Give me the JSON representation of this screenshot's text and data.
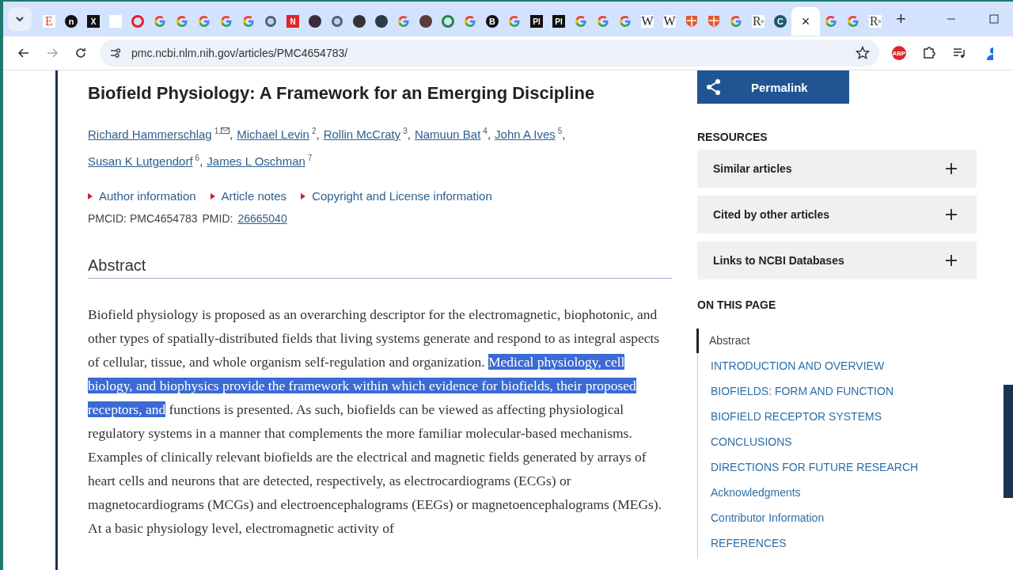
{
  "browser": {
    "tabs": [
      {
        "kind": "letter",
        "glyph": "E",
        "color": "#d9472b",
        "selected": false
      },
      {
        "kind": "round",
        "glyph": "n",
        "color": "#111111",
        "selected": false
      },
      {
        "kind": "square",
        "glyph": "X",
        "color": "#111111",
        "selected": false
      },
      {
        "kind": "blank",
        "selected": false
      },
      {
        "kind": "ring",
        "color": "#e0242b",
        "selected": false
      },
      {
        "kind": "google",
        "selected": false
      },
      {
        "kind": "google",
        "selected": false
      },
      {
        "kind": "google",
        "selected": false
      },
      {
        "kind": "google",
        "selected": false
      },
      {
        "kind": "google",
        "selected": false
      },
      {
        "kind": "seal",
        "color": "#4a5f86",
        "selected": false
      },
      {
        "kind": "square",
        "glyph": "N",
        "color": "#e0242b",
        "selected": false
      },
      {
        "kind": "dot",
        "color": "#3b2b3a",
        "selected": false
      },
      {
        "kind": "seal",
        "color": "#4a5f86",
        "selected": false
      },
      {
        "kind": "dot",
        "color": "#333333",
        "selected": false
      },
      {
        "kind": "dot",
        "color": "#2d3a4a",
        "selected": false
      },
      {
        "kind": "google",
        "selected": false
      },
      {
        "kind": "dot",
        "color": "#5a3a3a",
        "selected": false
      },
      {
        "kind": "ring",
        "color": "#1e8a4a",
        "selected": false
      },
      {
        "kind": "google",
        "selected": false
      },
      {
        "kind": "round",
        "glyph": "B",
        "color": "#111111",
        "selected": false
      },
      {
        "kind": "google",
        "selected": false
      },
      {
        "kind": "square",
        "glyph": "PI",
        "color": "#111111",
        "selected": false
      },
      {
        "kind": "square",
        "glyph": "PI",
        "color": "#111111",
        "selected": false
      },
      {
        "kind": "google",
        "selected": false
      },
      {
        "kind": "google",
        "selected": false
      },
      {
        "kind": "google",
        "selected": false
      },
      {
        "kind": "letter",
        "glyph": "W",
        "color": "#222222",
        "selected": false
      },
      {
        "kind": "letter",
        "glyph": "W",
        "color": "#222222",
        "selected": false
      },
      {
        "kind": "shield",
        "color": "#e05a2b",
        "selected": false
      },
      {
        "kind": "shield",
        "color": "#e05a2b",
        "selected": false
      },
      {
        "kind": "google",
        "selected": false
      },
      {
        "kind": "letter",
        "glyph": "R",
        "sup": "6",
        "color": "#333333",
        "selected": false
      },
      {
        "kind": "round",
        "glyph": "C",
        "color": "#1a5a70",
        "selected": false
      },
      {
        "kind": "active",
        "close": "×",
        "selected": true
      },
      {
        "kind": "google",
        "selected": false
      },
      {
        "kind": "google",
        "selected": false
      },
      {
        "kind": "letter",
        "glyph": "R",
        "sup": "6",
        "color": "#333333",
        "selected": false
      }
    ],
    "new_tab": "+",
    "url": "pmc.ncbi.nlm.nih.gov/articles/PMC4654783/",
    "extension_badge": "ABP"
  },
  "article": {
    "title": "Biofield Physiology: A Framework for an Emerging Discipline",
    "authors": [
      {
        "name": "Richard Hammerschlag",
        "sup": "1,",
        "mail": true,
        "separator": ","
      },
      {
        "name": "Michael Levin",
        "sup": "2",
        "mail": false,
        "separator": ","
      },
      {
        "name": "Rollin McCraty",
        "sup": "3",
        "mail": false,
        "separator": ","
      },
      {
        "name": "Namuun Bat",
        "sup": "4",
        "mail": false,
        "separator": ","
      },
      {
        "name": "John A Ives",
        "sup": "5",
        "mail": false,
        "separator": ","
      },
      {
        "name": "Susan K Lutgendorf",
        "sup": "6",
        "mail": false,
        "separator": ","
      },
      {
        "name": "James L Oschman",
        "sup": "7",
        "mail": false
      }
    ],
    "info_links": [
      "Author information",
      "Article notes",
      "Copyright and License information"
    ],
    "pmcid_label": "PMCID: PMC4654783",
    "pmid_label": "PMID:",
    "pmid": "26665040",
    "section_heading": "Abstract",
    "abstract": [
      {
        "text": "Biofield physiology is proposed as an overarching descriptor for the electromagnetic, biophotonic, and other types of spatially-distributed fields that living systems generate and respond to as integral aspects of cellular, tissue, and whole organism self-regulation and organization. ",
        "selected": false
      },
      {
        "text": "Medical physiology, cell biology, and biophysics provide the framework within which evidence for biofields, their proposed receptors, and",
        "selected": true
      },
      {
        "text": " functions is presented. As such, biofields can be viewed as affecting physiological regulatory systems in a manner that complements the more familiar molecular-based mechanisms. Examples of clinically relevant biofields are the electrical and magnetic fields generated by arrays of heart cells and neurons that are detected, respectively, as electrocardiograms (ECGs) or magnetocardiograms (MCGs) and electroencephalograms (EEGs) or magnetoencephalograms (MEGs). At a basic physiology level, electromagnetic activity of",
        "selected": false
      }
    ]
  },
  "sidebar": {
    "permalink": "Permalink",
    "resources_heading": "RESOURCES",
    "resources": [
      {
        "label": "Similar articles",
        "expanded": false
      },
      {
        "label": "Cited by other articles",
        "expanded": false
      },
      {
        "label": "Links to NCBI Databases",
        "expanded": false
      }
    ],
    "toc_heading": "ON THIS PAGE",
    "toc": [
      {
        "label": "Abstract",
        "selected": true
      },
      {
        "label": "INTRODUCTION AND OVERVIEW",
        "selected": false
      },
      {
        "label": "BIOFIELDS: FORM AND FUNCTION",
        "selected": false
      },
      {
        "label": "BIOFIELD RECEPTOR SYSTEMS",
        "selected": false
      },
      {
        "label": "CONCLUSIONS",
        "selected": false
      },
      {
        "label": "DIRECTIONS FOR FUTURE RESEARCH",
        "selected": false
      },
      {
        "label": "Acknowledgments",
        "selected": false
      },
      {
        "label": "Contributor Information",
        "selected": false
      },
      {
        "label": "REFERENCES",
        "selected": false
      }
    ]
  }
}
